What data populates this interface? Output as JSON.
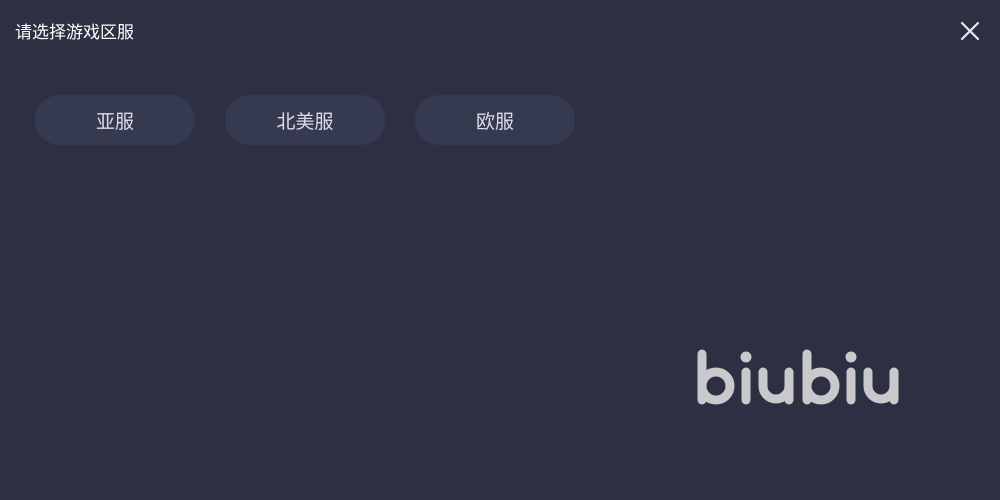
{
  "dialog": {
    "title": "请选择游戏区服",
    "close_icon": "close-icon"
  },
  "servers": [
    {
      "label": "亚服"
    },
    {
      "label": "北美服"
    },
    {
      "label": "欧服"
    }
  ],
  "brand": {
    "logo_text": "biubiu"
  },
  "colors": {
    "background": "#2d2f42",
    "button_bg": "#363a51",
    "button_text": "#dcdde3",
    "title_text": "#ffffff",
    "logo": "#c9c9cc"
  }
}
